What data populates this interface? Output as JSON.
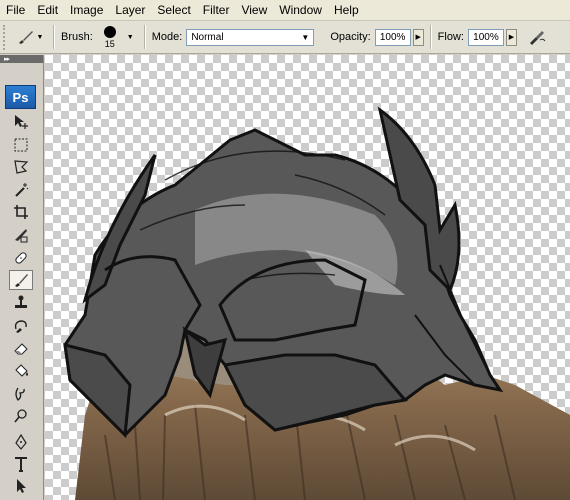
{
  "menu": [
    "File",
    "Edit",
    "Image",
    "Layer",
    "Select",
    "Filter",
    "View",
    "Window",
    "Help"
  ],
  "options": {
    "brush_label": "Brush:",
    "brush_size": "15",
    "mode_label": "Mode:",
    "mode_value": "Normal",
    "opacity_label": "Opacity:",
    "opacity_value": "100%",
    "flow_label": "Flow:",
    "flow_value": "100%"
  },
  "tools_panel": {
    "logo": "Ps",
    "tools": [
      "move-icon",
      "marquee-icon",
      "lasso-icon",
      "magic-wand-icon",
      "crop-icon",
      "slice-icon",
      "healing-brush-icon",
      "brush-icon",
      "clone-stamp-icon",
      "history-brush-icon",
      "eraser-icon",
      "paint-bucket-icon",
      "blur-icon",
      "dodge-icon",
      "pen-icon",
      "type-icon",
      "path-selection-icon"
    ],
    "active_tool": "brush-icon"
  },
  "colors": {
    "menubar_bg": "#ece9d8",
    "helmet": "#4f4f4f",
    "eye": "#d89a4a"
  }
}
